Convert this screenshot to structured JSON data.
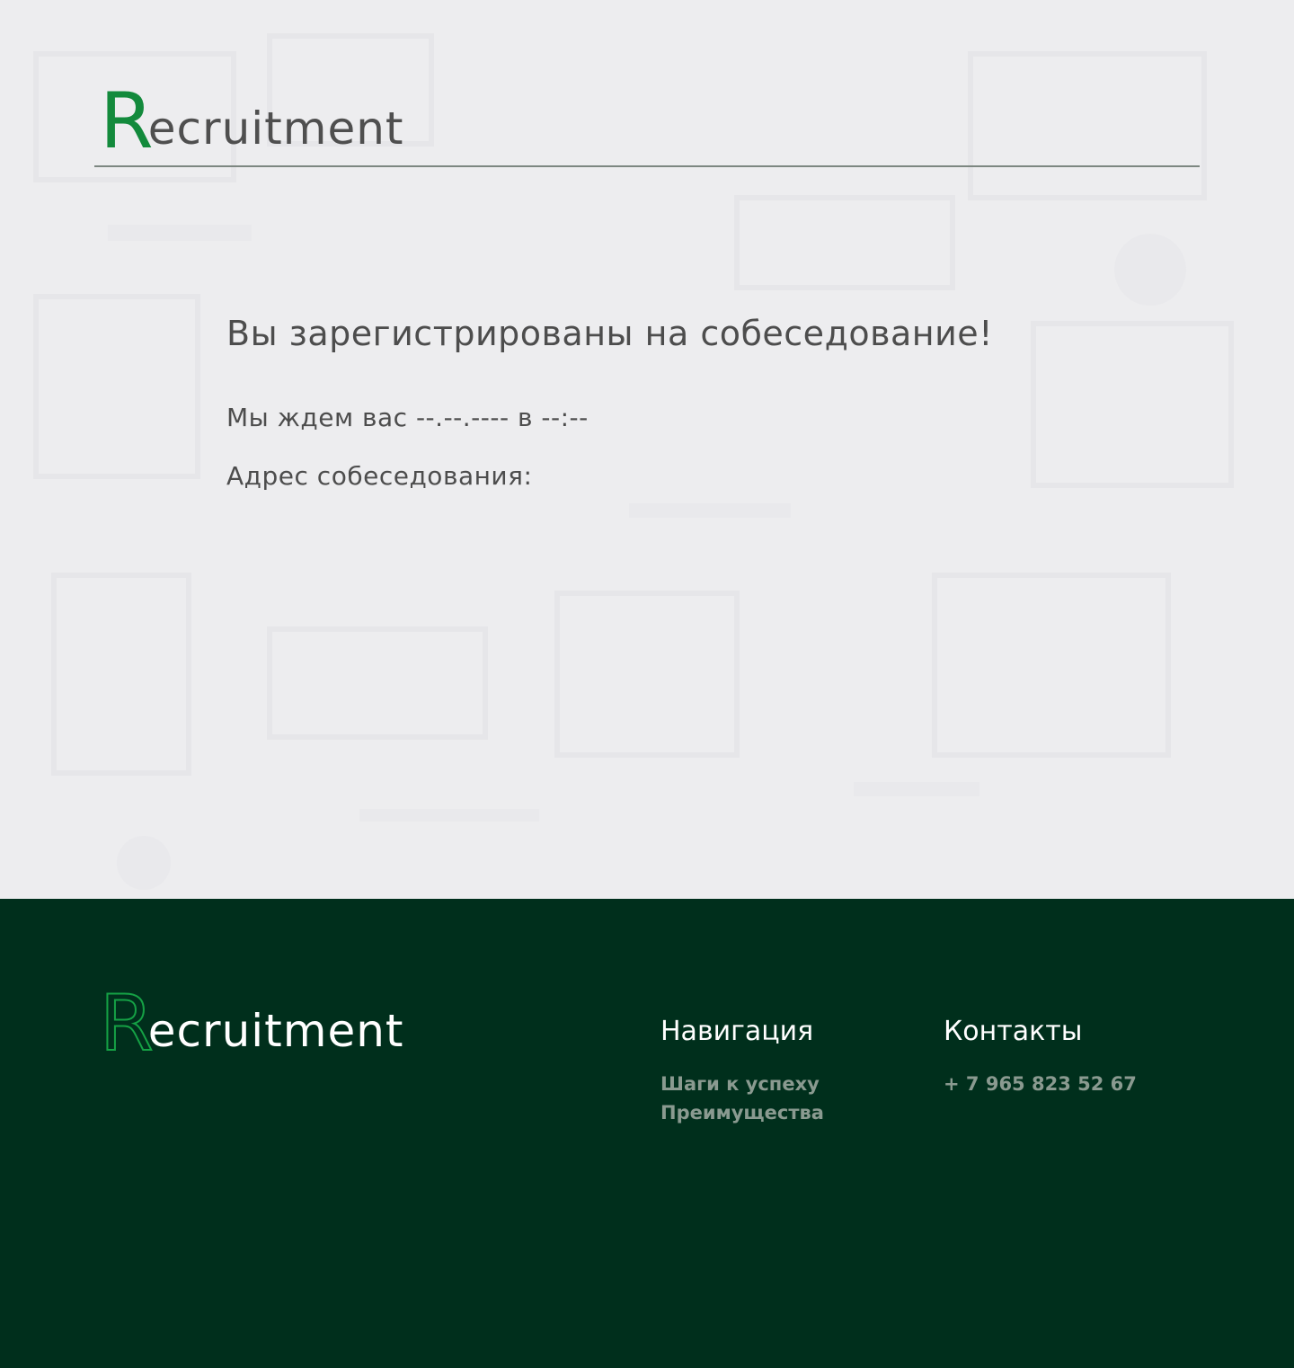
{
  "header": {
    "logo_initial": "R",
    "logo_rest": "ecruitment"
  },
  "main": {
    "title": "Вы зарегистрированы на собеседование!",
    "waiting_text": "Мы ждем вас --.--.---- в --:--",
    "address_label": "Адрес собеседования:"
  },
  "footer": {
    "logo_initial": "R",
    "logo_rest": "ecruitment",
    "navigation": {
      "heading": "Навигация",
      "links": [
        "Шаги к успеху",
        "Преимущества"
      ]
    },
    "contacts": {
      "heading": "Контакты",
      "phone": "+ 7 965 823 52 67"
    }
  },
  "colors": {
    "brand_green": "#138a3c",
    "footer_background": "#002f1c",
    "page_background": "#ededef",
    "text_dark": "#4d4d4d",
    "footer_link": "#8a9a90"
  }
}
